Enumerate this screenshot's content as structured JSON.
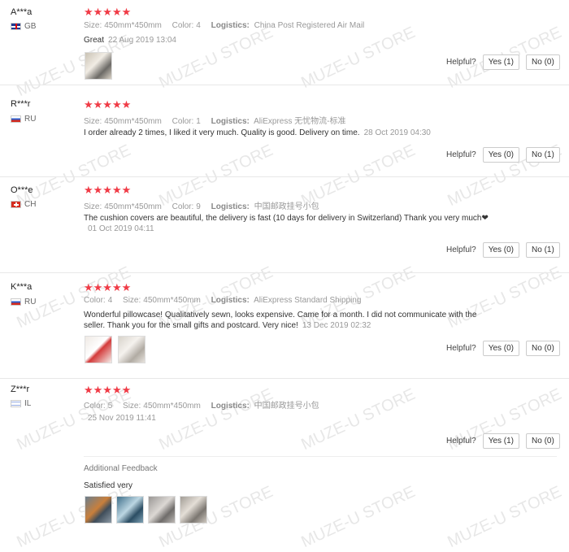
{
  "watermark": "MUZE-U STORE",
  "helpful_label": "Helpful?",
  "reviews": [
    {
      "buyer": "A***a",
      "country": "GB",
      "stars": "★★★★★",
      "size_k": "Size:",
      "size_v": "450mm*450mm",
      "color_k": "Color:",
      "color_v": "4",
      "log_k": "Logistics:",
      "log_v": "China Post Registered Air Mail",
      "text": "Great",
      "date": "22 Aug 2019 13:04",
      "yes": "Yes (1)",
      "no": "No (0)"
    },
    {
      "buyer": "R***r",
      "country": "RU",
      "stars": "★★★★★",
      "size_k": "Size:",
      "size_v": "450mm*450mm",
      "color_k": "Color:",
      "color_v": "1",
      "log_k": "Logistics:",
      "log_v": "AliExpress 无忧物流-标准",
      "text": "I order already 2 times, I liked it very much. Quality is good. Delivery on time.",
      "date": "28 Oct 2019 04:30",
      "yes": "Yes (0)",
      "no": "No (1)"
    },
    {
      "buyer": "O***e",
      "country": "CH",
      "stars": "★★★★★",
      "size_k": "Size:",
      "size_v": "450mm*450mm",
      "color_k": "Color:",
      "color_v": "9",
      "log_k": "Logistics:",
      "log_v": "中国邮政挂号小包",
      "text": "The cushion covers are beautiful, the delivery is fast (10 days for delivery in Switzerland) Thank you very much❤",
      "date": "01 Oct 2019 04:11",
      "yes": "Yes (0)",
      "no": "No (1)"
    },
    {
      "buyer": "K***a",
      "country": "RU",
      "stars": "★★★★★",
      "color_k": "Color:",
      "color_v": "4",
      "size_k": "Size:",
      "size_v": "450mm*450mm",
      "log_k": "Logistics:",
      "log_v": "AliExpress Standard Shipping",
      "text": "Wonderful pillowcase! Qualitatively sewn, looks expensive. Came for a month. I did not communicate with the seller. Thank you for the small gifts and postcard. Very nice!",
      "date": "13 Dec 2019 02:32",
      "yes": "Yes (0)",
      "no": "No (0)"
    },
    {
      "buyer": "Z***r",
      "country": "IL",
      "stars": "★★★★★",
      "color_k": "Color:",
      "color_v": "5",
      "size_k": "Size:",
      "size_v": "450mm*450mm",
      "log_k": "Logistics:",
      "log_v": "中国邮政挂号小包",
      "text": "",
      "date": "25 Nov 2019 11:41",
      "yes": "Yes (1)",
      "no": "No (0)",
      "additional_label": "Additional Feedback",
      "additional_text": "Satisfied very"
    }
  ]
}
